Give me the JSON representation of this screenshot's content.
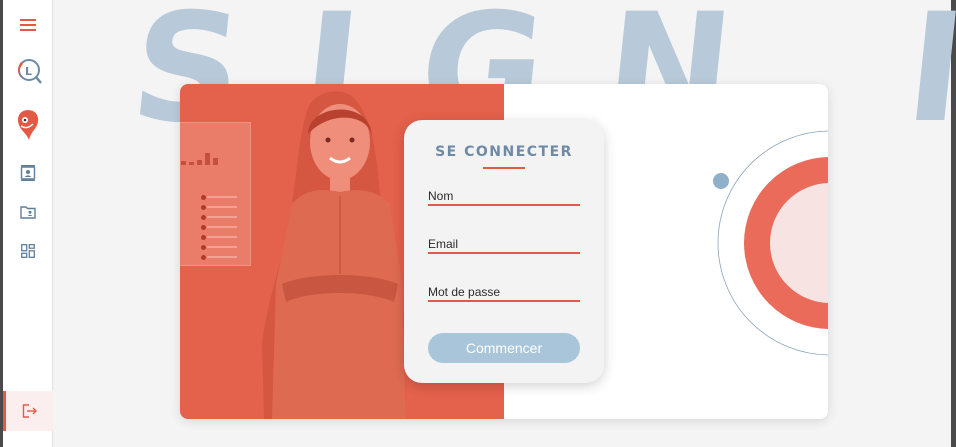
{
  "sidebar": {
    "items": [
      {
        "icon": "menu-icon"
      },
      {
        "icon": "app-logo-icon"
      },
      {
        "icon": "mascot-icon"
      },
      {
        "icon": "contact-card-icon"
      },
      {
        "icon": "folder-user-icon"
      },
      {
        "icon": "dashboard-icon"
      }
    ],
    "logout_icon": "logout-icon"
  },
  "hero": {
    "background_text": "SIGN IN"
  },
  "login": {
    "title": "SE CONNECTER",
    "fields": {
      "name_placeholder": "Nom",
      "email_placeholder": "Email",
      "password_placeholder": "Mot de passe"
    },
    "submit_label": "Commencer"
  },
  "colors": {
    "accent": "#e25a46",
    "blue": "#a9c5da",
    "title_blue": "#6d8aa6"
  }
}
